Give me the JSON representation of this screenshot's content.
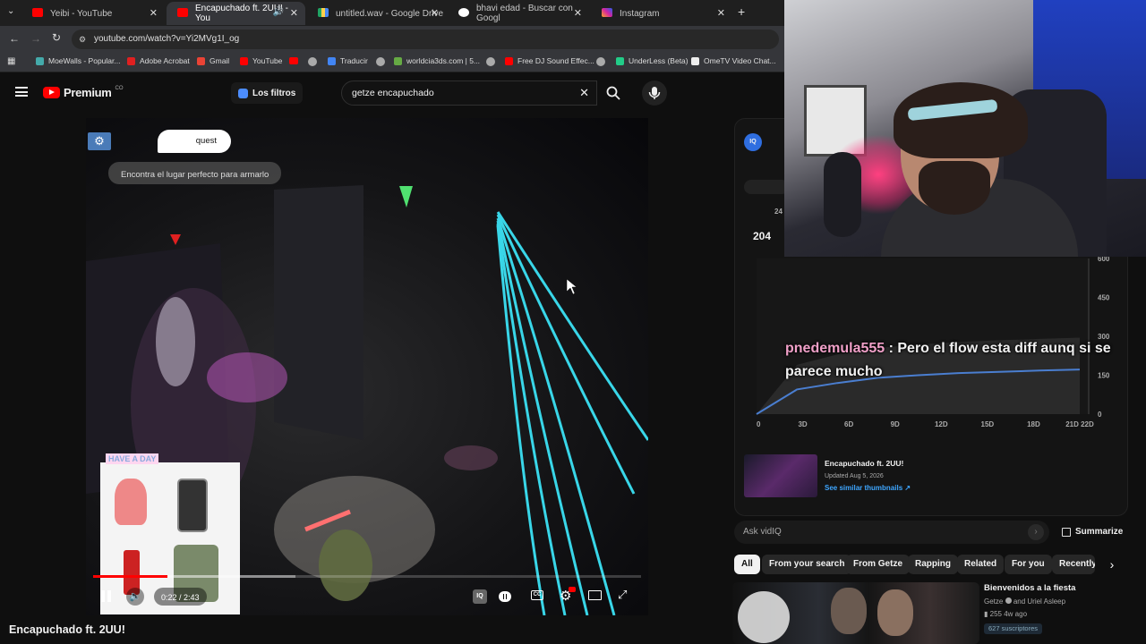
{
  "browser": {
    "tabs": [
      {
        "label": "Yeibi - YouTube",
        "active": false
      },
      {
        "label": "Encapuchado ft. 2UU! - You",
        "active": true
      },
      {
        "label": "untitled.wav - Google Drive",
        "active": false
      },
      {
        "label": "bhavi edad - Buscar con Googl",
        "active": false
      },
      {
        "label": "Instagram",
        "active": false
      }
    ],
    "url": "youtube.com/watch?v=Yi2MVg1I_og",
    "bookmarks": [
      "MoeWalls - Popular...",
      "Adobe Acrobat",
      "Gmail",
      "YouTube",
      "Traducir",
      "worldcia3ds.com | 5...",
      "Free DJ Sound Effec...",
      "UnderLess (Beta)",
      "OmeTV Video Chat..."
    ]
  },
  "youtube": {
    "logo_text": "Premium",
    "country": "CO",
    "filters_label": "Los filtros",
    "search_value": "getze encapuchado"
  },
  "video": {
    "quest_label": "quest",
    "quest_text": "Encontra el lugar perfecto para armarlo",
    "sticker_label": "HAVE A DAY",
    "time": "0:22 / 2:43",
    "progress": 0.135,
    "buffered": 0.37,
    "title": "Encapuchado ft. 2UU!"
  },
  "panel": {
    "views_count": "204",
    "partial_24": "24",
    "chart_data": {
      "type": "area",
      "x_ticks": [
        "0",
        "3D",
        "6D",
        "9D",
        "12D",
        "15D",
        "18D",
        "21D 22D"
      ],
      "y_ticks": [
        "600",
        "450",
        "300",
        "150",
        "0"
      ],
      "series": [
        {
          "values": [
            0,
            95,
            120,
            140,
            150,
            158,
            163,
            168,
            172
          ]
        },
        {
          "values": [
            0,
            190,
            230,
            255,
            268,
            278,
            285,
            290,
            295
          ]
        }
      ]
    },
    "chat": {
      "user": "pnedemula555",
      "separator": " : ",
      "message": "Pero el flow esta diff aunq si se parece mucho"
    },
    "thumb": {
      "title": "Encapuchado ft. 2UU!",
      "updated": "Updated Aug 5, 2026",
      "link": "See similar thumbnails"
    },
    "ask_placeholder": "Ask vidIQ",
    "summarize": "Summarize"
  },
  "chips": [
    "All",
    "From your search",
    "From Getze",
    "Rapping",
    "Related",
    "For you",
    "Recently"
  ],
  "recommended": {
    "title": "Bienvenidos a la fiesta",
    "channel": "Getze",
    "channel_suffix": "and Uriel Asleep",
    "views": "255",
    "age": "4w ago",
    "subs": "627 suscriptores"
  },
  "colors": {
    "yt_red": "#ff0000",
    "chat_user": "#f0a0c8",
    "link_blue": "#3ea6ff",
    "laser": "#39d6e8"
  }
}
